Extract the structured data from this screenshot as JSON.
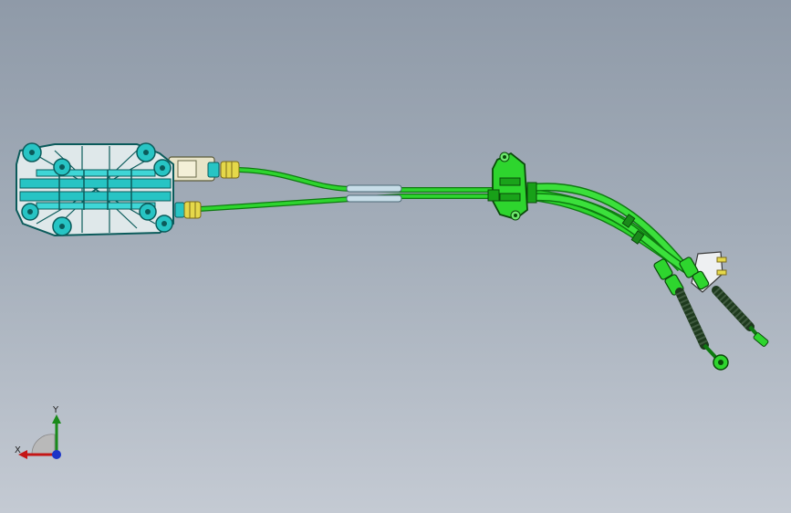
{
  "viewport": {
    "background_top": "#8f9aa8",
    "background_bottom": "#c4cad3"
  },
  "colors": {
    "cable_green": "#2ed52e",
    "cable_dark": "#0e7a10",
    "bracket_cyan": "#27c4c4",
    "bracket_dark": "#0b5b5b",
    "fitting_yellow": "#e5d84a",
    "sleeve_gray": "#c7dde8",
    "boot_dark": "#1e3a1e"
  },
  "icons": {
    "triad": "view-orientation-triad-icon",
    "shifter": "shifter-bracket-assembly",
    "grommet": "bulkhead-grommet",
    "ends": "cable-end-fittings"
  },
  "triad": {
    "x_label": "X",
    "y_label": "Y"
  }
}
